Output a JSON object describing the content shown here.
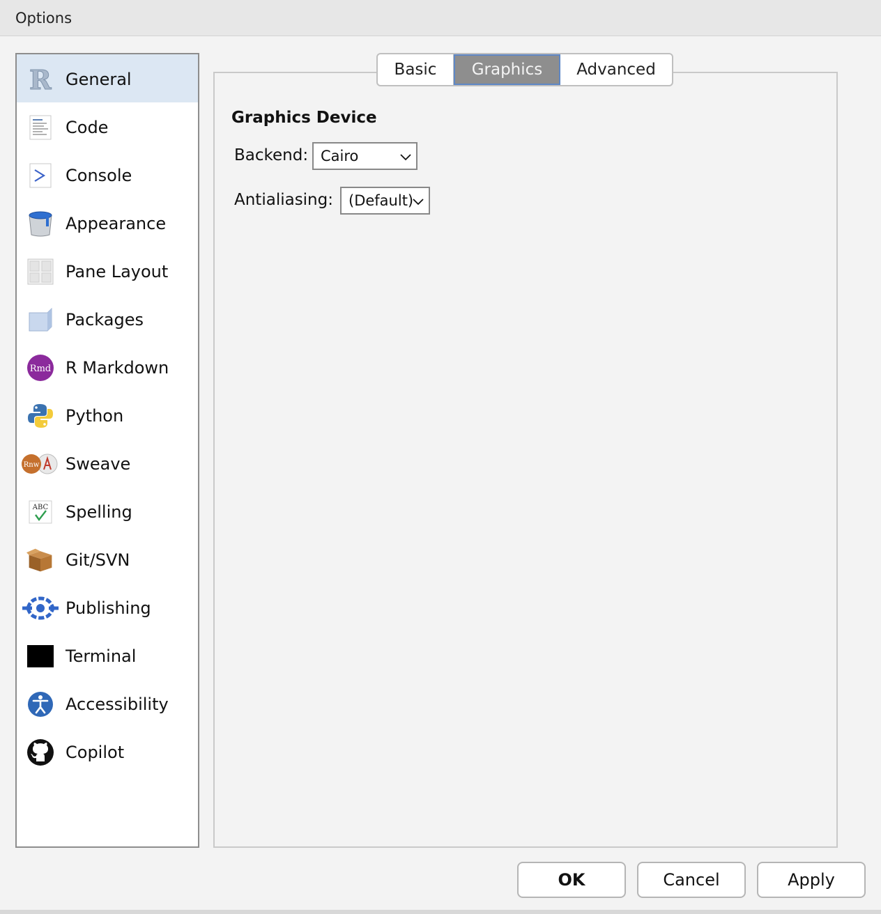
{
  "window": {
    "title": "Options"
  },
  "sidebar": {
    "items": [
      {
        "label": "General",
        "icon": "r-logo-icon",
        "selected": true
      },
      {
        "label": "Code",
        "icon": "code-document-icon"
      },
      {
        "label": "Console",
        "icon": "console-prompt-icon"
      },
      {
        "label": "Appearance",
        "icon": "paint-bucket-icon"
      },
      {
        "label": "Pane Layout",
        "icon": "pane-grid-icon"
      },
      {
        "label": "Packages",
        "icon": "package-box-icon"
      },
      {
        "label": "R Markdown",
        "icon": "rmd-icon",
        "icon_text": "Rmd"
      },
      {
        "label": "Python",
        "icon": "python-icon"
      },
      {
        "label": "Sweave",
        "icon": "sweave-icon",
        "icon_text": "Rnw"
      },
      {
        "label": "Spelling",
        "icon": "spelling-check-icon",
        "icon_text": "ABC"
      },
      {
        "label": "Git/SVN",
        "icon": "git-box-icon"
      },
      {
        "label": "Publishing",
        "icon": "publishing-icon"
      },
      {
        "label": "Terminal",
        "icon": "terminal-icon"
      },
      {
        "label": "Accessibility",
        "icon": "accessibility-icon"
      },
      {
        "label": "Copilot",
        "icon": "github-icon"
      }
    ]
  },
  "tabs": [
    {
      "label": "Basic"
    },
    {
      "label": "Graphics",
      "active": true
    },
    {
      "label": "Advanced"
    }
  ],
  "graphics": {
    "section_title": "Graphics Device",
    "backend_label": "Backend:",
    "backend_value": "Cairo",
    "antialiasing_label": "Antialiasing:",
    "antialiasing_value": "(Default)"
  },
  "buttons": {
    "ok": "OK",
    "cancel": "Cancel",
    "apply": "Apply"
  },
  "colors": {
    "selected_row": "#dce7f3",
    "active_tab": "#8e8e8e",
    "active_tab_border": "#5e87c5"
  }
}
